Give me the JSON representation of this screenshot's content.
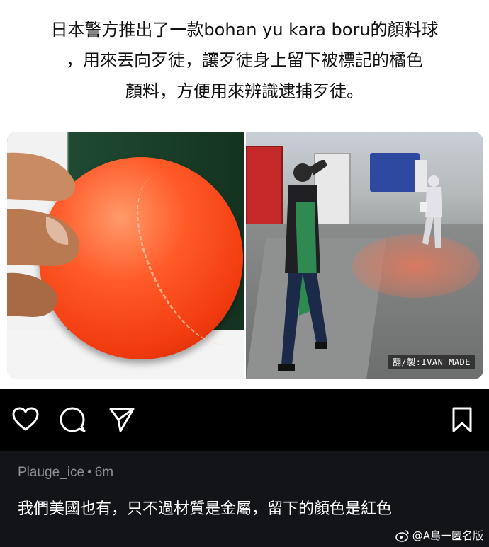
{
  "headline": {
    "line1": "日本警方推出了一款bohan yu kara boru的顏料球",
    "line2": "，用來丟向歹徒，讓歹徒身上留下被標記的橘色",
    "line3": "顏料，方便用來辨識逮捕歹徒。"
  },
  "photo": {
    "watermark": "翻/製:IVAN MADE"
  },
  "actions": {
    "like_icon": "heart-icon",
    "comment_icon": "comment-bubble-icon",
    "share_icon": "paper-plane-icon",
    "save_icon": "bookmark-icon"
  },
  "comment": {
    "username": "Plauge_ice",
    "separator": "•",
    "time": "6m",
    "text": "我們美國也有，只不過材質是金屬，留下的顏色是紅色"
  },
  "source": {
    "label": "@A島一匿名版"
  },
  "colors": {
    "action_bar_bg": "#000000",
    "comment_bg": "#121418",
    "meta_text": "#8e8e93",
    "ball_orange": "#f23c10"
  }
}
